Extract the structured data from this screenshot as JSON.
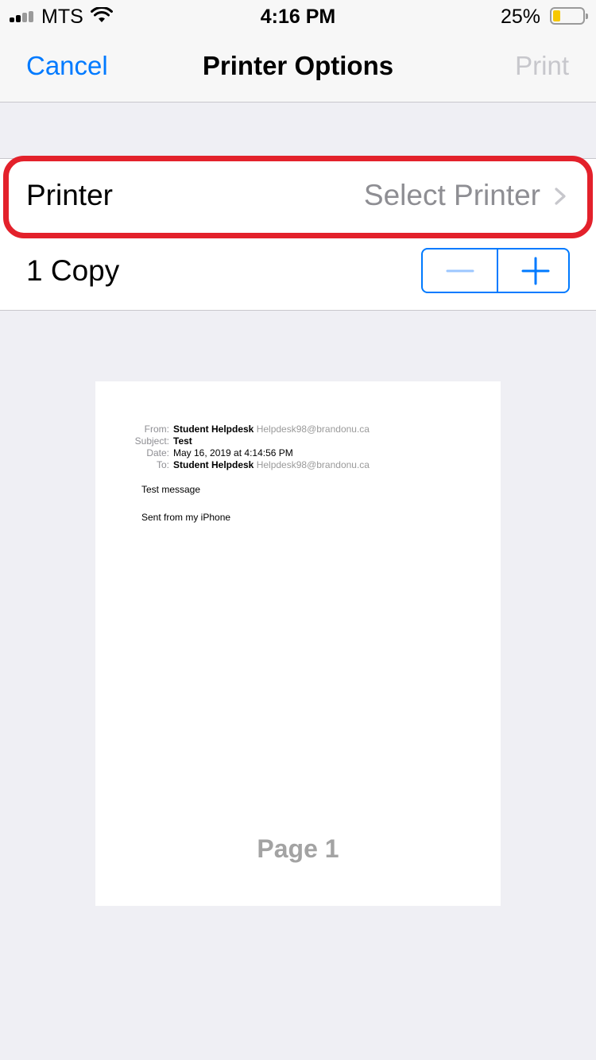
{
  "status_bar": {
    "carrier": "MTS",
    "time": "4:16 PM",
    "battery_percent": "25%",
    "battery_level": 0.25,
    "icons": [
      "signal-bars-icon",
      "wifi-icon",
      "battery-icon"
    ]
  },
  "nav": {
    "cancel_label": "Cancel",
    "title": "Printer Options",
    "print_label": "Print"
  },
  "printer_row": {
    "label": "Printer",
    "value": "Select Printer",
    "icon": "chevron-right-icon"
  },
  "copies_row": {
    "label": "1 Copy",
    "minus_icon": "minus-icon",
    "plus_icon": "plus-icon"
  },
  "preview": {
    "headers": [
      {
        "key": "From:",
        "value": "Student Helpdesk",
        "extra": "Helpdesk98@brandonu.ca"
      },
      {
        "key": "Subject:",
        "value": "Test",
        "extra": ""
      },
      {
        "key": "Date:",
        "value": "May 16, 2019 at 4:14:56 PM",
        "extra": ""
      },
      {
        "key": "To:",
        "value": "Student Helpdesk",
        "extra": "Helpdesk98@brandonu.ca"
      }
    ],
    "body_lines": [
      "Test message",
      "Sent from my iPhone"
    ],
    "page_label": "Page 1"
  },
  "colors": {
    "accent": "#007aff",
    "highlight": "#e3212b",
    "disabled": "#c7c7cc",
    "battery": "#f7c800"
  }
}
